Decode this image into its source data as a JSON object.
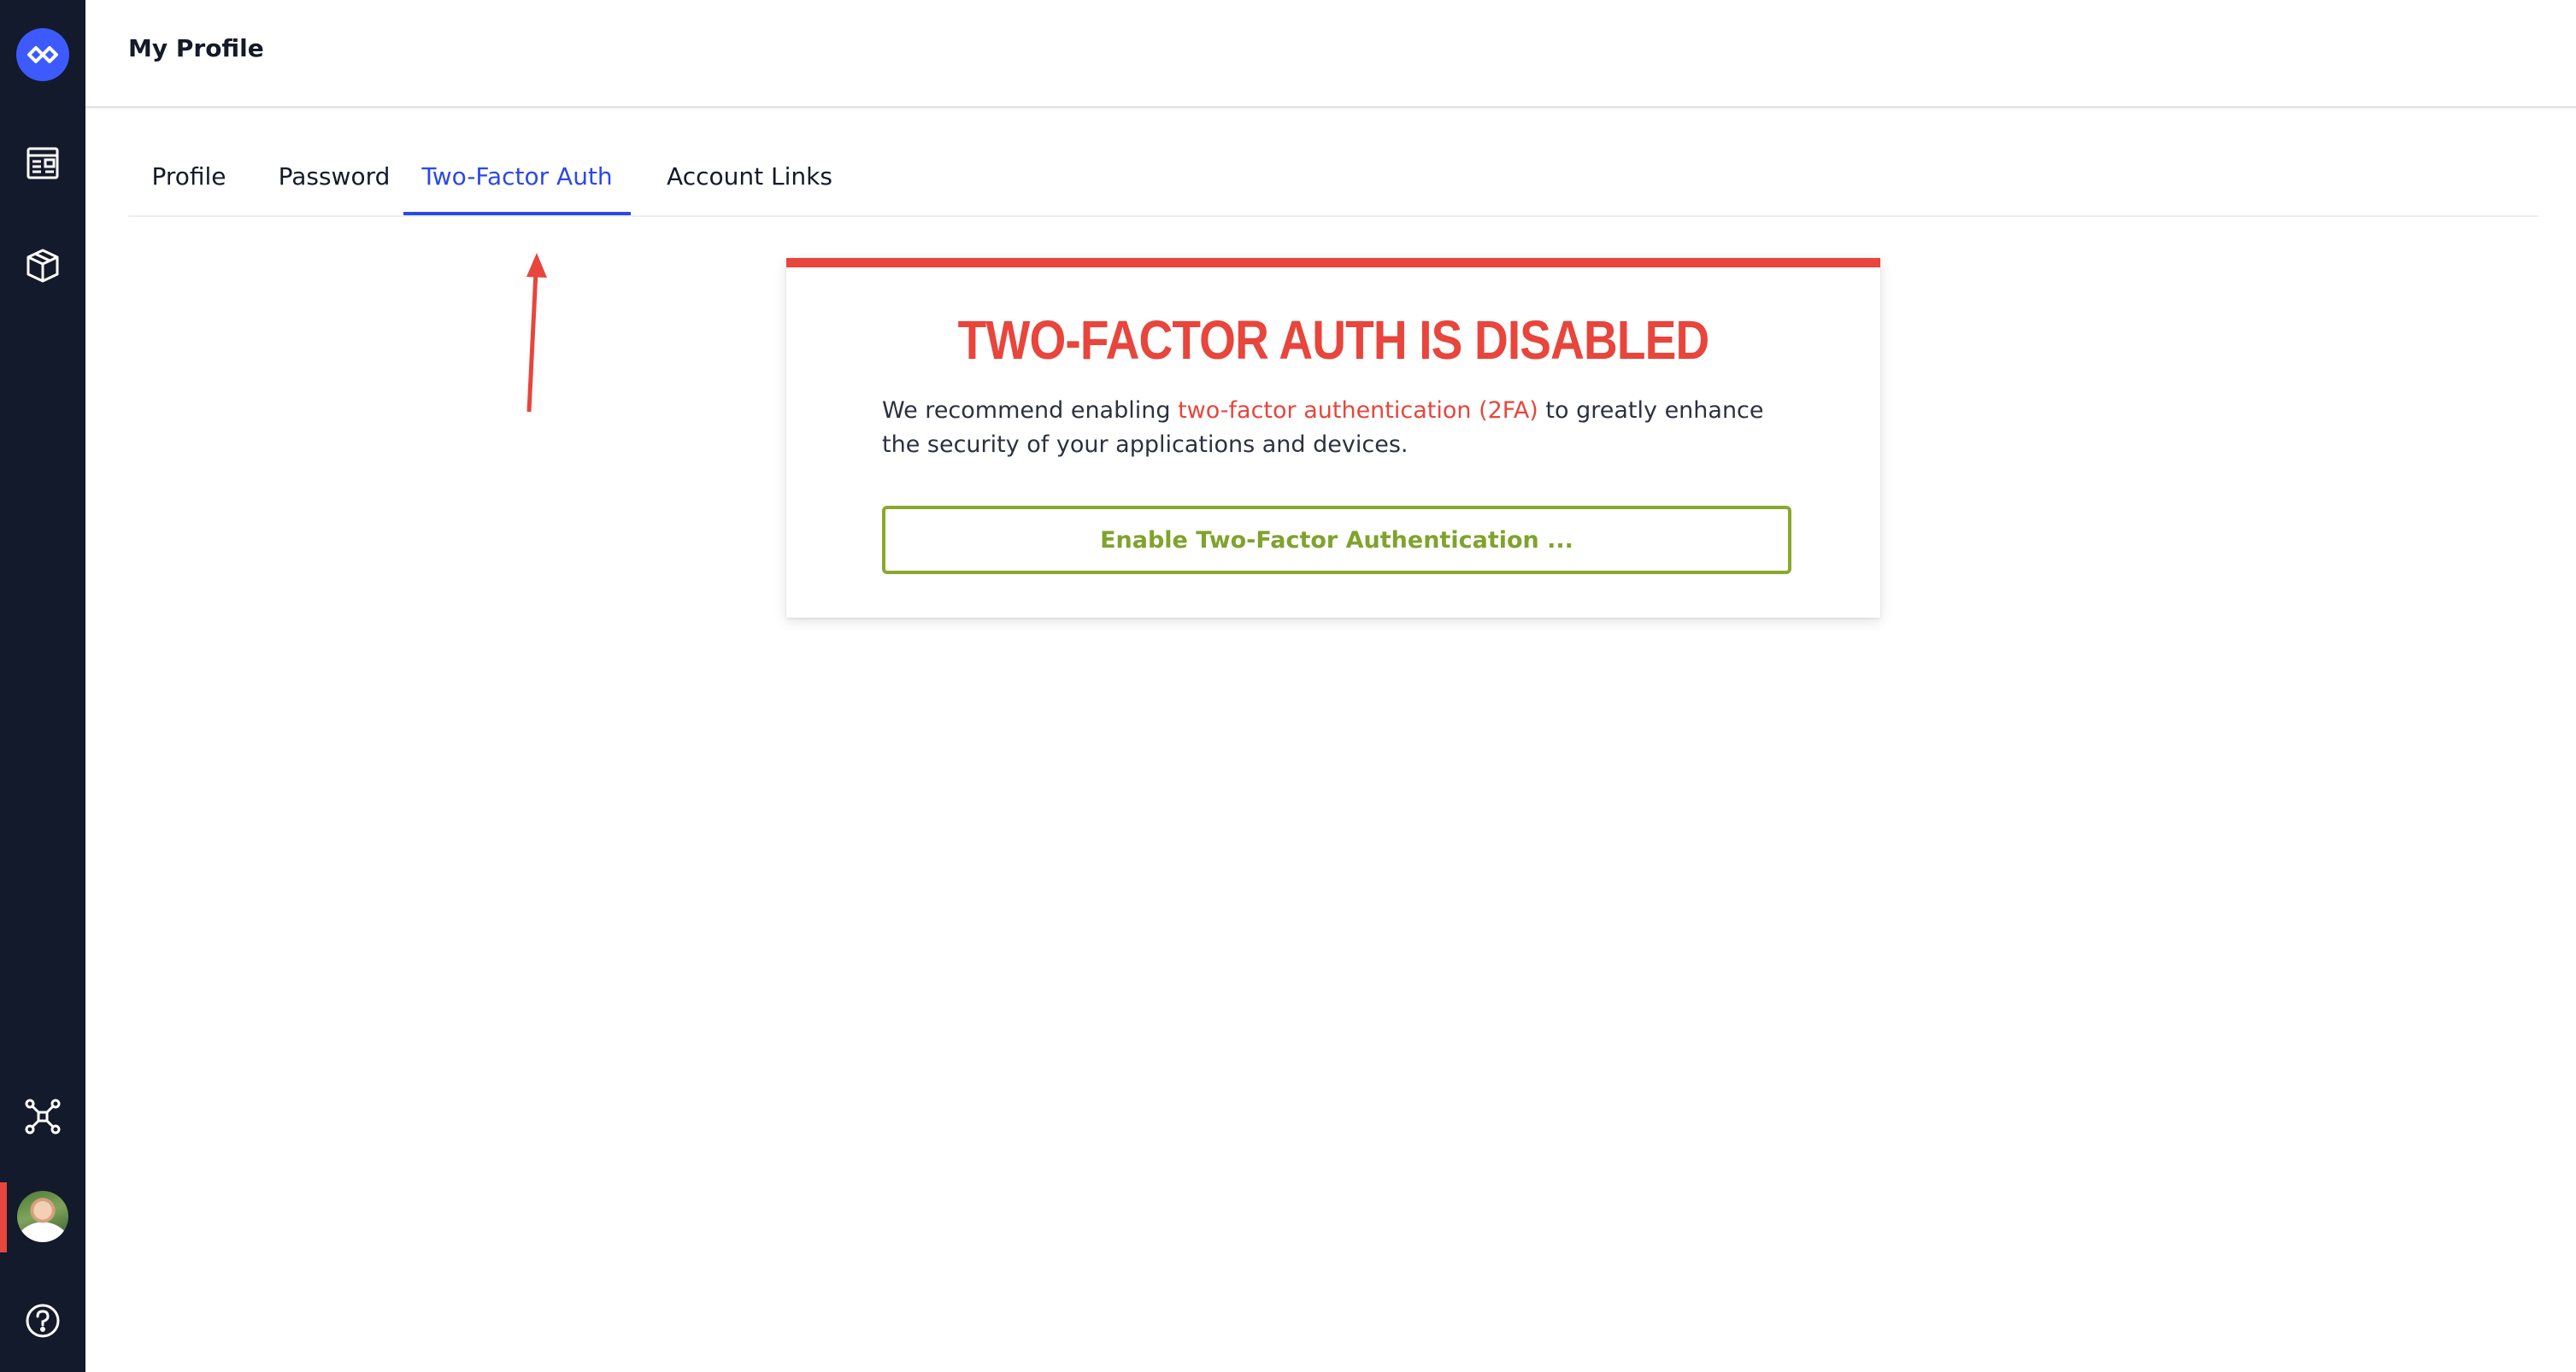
{
  "header": {
    "title": "My Profile"
  },
  "sidebar": {
    "icons": [
      "logo-icon",
      "dashboard-icon",
      "package-icon",
      "network-icon",
      "avatar",
      "help-icon"
    ],
    "active_color": "#e8453c"
  },
  "tabs": [
    {
      "label": "Profile"
    },
    {
      "label": "Password"
    },
    {
      "label": "Two-Factor Auth",
      "active": true
    },
    {
      "label": "Account Links"
    }
  ],
  "card": {
    "title": "TWO-FACTOR AUTH IS DISABLED",
    "text_before": "We recommend enabling ",
    "link_text": "two-factor authentication (2FA)",
    "text_after": " to greatly enhance the security of your applications and devices.",
    "button_label": "Enable Two-Factor Authentication ...",
    "accent_color": "#e8453c",
    "button_color": "#88a92e"
  },
  "colors": {
    "primary": "#2b49e8",
    "sidebar_bg": "#131a2b"
  }
}
